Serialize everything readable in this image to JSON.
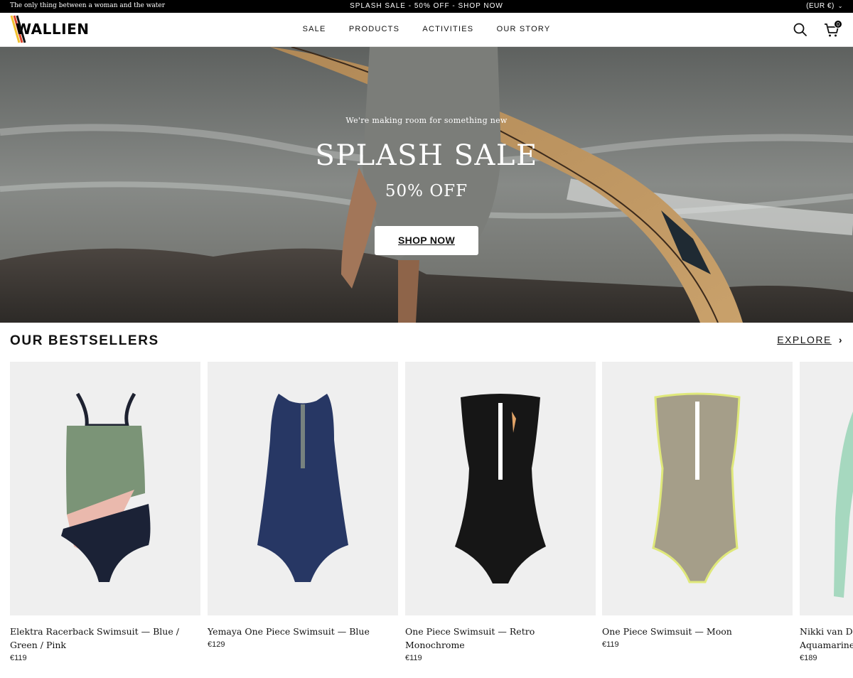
{
  "announcement": {
    "tagline": "The only thing between a woman and the water",
    "promo": "SPLASH SALE - 50% OFF - SHOP NOW",
    "currency": "(EUR €)"
  },
  "header": {
    "logo": "WALLIEN",
    "nav": [
      "SALE",
      "PRODUCTS",
      "ACTIVITIES",
      "OUR STORY"
    ],
    "cart_count": "0"
  },
  "hero": {
    "subtitle": "We're making room for something new",
    "title": "SPLASH SALE",
    "discount": "50% OFF",
    "cta": "SHOP NOW"
  },
  "bestsellers": {
    "title": "OUR BESTSELLERS",
    "explore": "EXPLORE",
    "products": [
      {
        "name": "Elektra Racerback Swimsuit — Blue / Green / Pink",
        "price": "€119"
      },
      {
        "name": "Yemaya One Piece Swimsuit — Blue",
        "price": "€129"
      },
      {
        "name": "One Piece Swimsuit — Retro Monochrome",
        "price": "€119"
      },
      {
        "name": "One Piece Swimsuit — Moon",
        "price": "€119"
      },
      {
        "name": "Nikki van Dijl Aquamarine G",
        "price": "€189"
      }
    ]
  },
  "colors": {
    "announcement_bg": "#000000",
    "card_bg": "#efefef",
    "logo_stripe_yellow": "#f2c12e",
    "logo_stripe_red": "#d9432b"
  }
}
